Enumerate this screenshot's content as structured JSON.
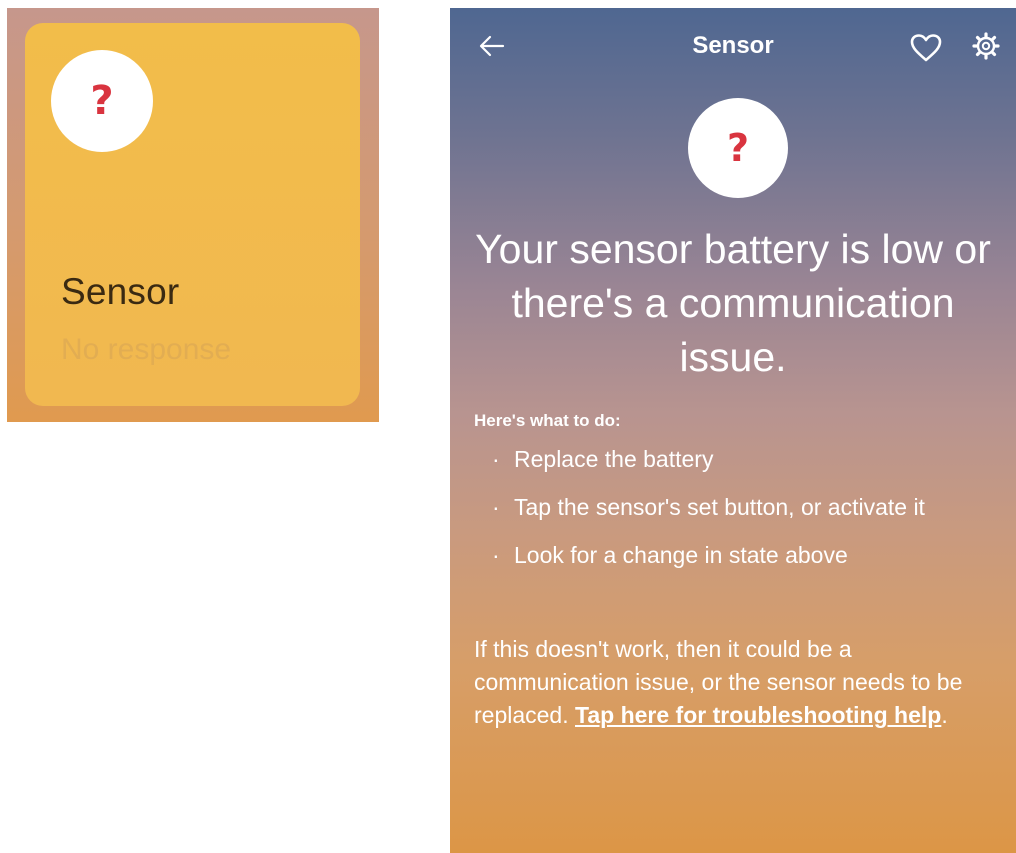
{
  "tile": {
    "title": "Sensor",
    "status": "No response",
    "icon": "question-mark-icon",
    "icon_glyph": "?"
  },
  "detail": {
    "nav": {
      "title": "Sensor",
      "back_icon": "back-arrow-icon",
      "favorite_icon": "heart-icon",
      "settings_icon": "gear-icon"
    },
    "status_icon_glyph": "?",
    "headline": "Your sensor battery is low or there's a communication issue.",
    "subhead": "Here's what to do:",
    "steps": [
      "Replace the battery",
      "Tap the sensor's set button, or activate it",
      "Look for a change in state above"
    ],
    "help_text": "If this doesn't work, then it could be a communication issue, or the sensor needs to be replaced.",
    "help_link": "Tap here for troubleshooting help",
    "help_suffix": "."
  },
  "colors": {
    "question_mark": "#d9343f",
    "tile_card": "#f2bd4a",
    "gradient_top": "#4f6791",
    "gradient_bottom": "#dc9646"
  }
}
